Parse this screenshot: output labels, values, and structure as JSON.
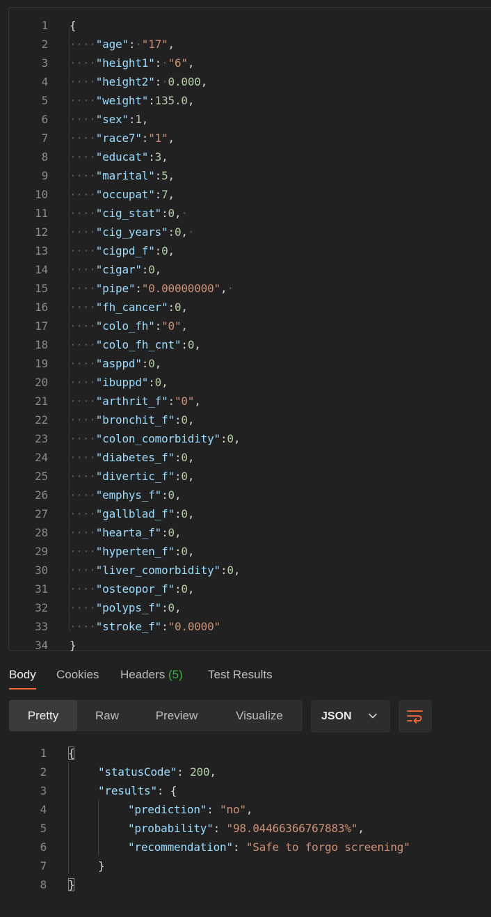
{
  "request_body": {
    "lines": [
      {
        "n": "1",
        "indent": 0,
        "tokens": [
          {
            "t": "{",
            "c": "pun"
          }
        ]
      },
      {
        "n": "2",
        "indent": 1,
        "tokens": [
          {
            "t": "\"age\"",
            "c": "key"
          },
          {
            "t": ":",
            "c": "pun"
          },
          {
            "t": "·",
            "c": "ws"
          },
          {
            "t": "\"17\"",
            "c": "str"
          },
          {
            "t": ",",
            "c": "pun"
          }
        ]
      },
      {
        "n": "3",
        "indent": 1,
        "tokens": [
          {
            "t": "\"height1\"",
            "c": "key"
          },
          {
            "t": ":",
            "c": "pun"
          },
          {
            "t": "·",
            "c": "ws"
          },
          {
            "t": "\"6\"",
            "c": "str"
          },
          {
            "t": ",",
            "c": "pun"
          }
        ]
      },
      {
        "n": "4",
        "indent": 1,
        "tokens": [
          {
            "t": "\"height2\"",
            "c": "key"
          },
          {
            "t": ":",
            "c": "pun"
          },
          {
            "t": "·",
            "c": "ws"
          },
          {
            "t": "0.000",
            "c": "num"
          },
          {
            "t": ",",
            "c": "pun"
          }
        ]
      },
      {
        "n": "5",
        "indent": 1,
        "tokens": [
          {
            "t": "\"weight\"",
            "c": "key"
          },
          {
            "t": ":",
            "c": "pun"
          },
          {
            "t": "135.0",
            "c": "num"
          },
          {
            "t": ",",
            "c": "pun"
          }
        ]
      },
      {
        "n": "6",
        "indent": 1,
        "tokens": [
          {
            "t": "\"sex\"",
            "c": "key"
          },
          {
            "t": ":",
            "c": "pun"
          },
          {
            "t": "1",
            "c": "num"
          },
          {
            "t": ",",
            "c": "pun"
          }
        ]
      },
      {
        "n": "7",
        "indent": 1,
        "tokens": [
          {
            "t": "\"race7\"",
            "c": "key"
          },
          {
            "t": ":",
            "c": "pun"
          },
          {
            "t": "\"1\"",
            "c": "str"
          },
          {
            "t": ",",
            "c": "pun"
          }
        ]
      },
      {
        "n": "8",
        "indent": 1,
        "tokens": [
          {
            "t": "\"educat\"",
            "c": "key"
          },
          {
            "t": ":",
            "c": "pun"
          },
          {
            "t": "3",
            "c": "num"
          },
          {
            "t": ",",
            "c": "pun"
          }
        ]
      },
      {
        "n": "9",
        "indent": 1,
        "tokens": [
          {
            "t": "\"marital\"",
            "c": "key"
          },
          {
            "t": ":",
            "c": "pun"
          },
          {
            "t": "5",
            "c": "num"
          },
          {
            "t": ",",
            "c": "pun"
          }
        ]
      },
      {
        "n": "10",
        "indent": 1,
        "tokens": [
          {
            "t": "\"occupat\"",
            "c": "key"
          },
          {
            "t": ":",
            "c": "pun"
          },
          {
            "t": "7",
            "c": "num"
          },
          {
            "t": ",",
            "c": "pun"
          }
        ]
      },
      {
        "n": "11",
        "indent": 1,
        "tokens": [
          {
            "t": "\"cig_stat\"",
            "c": "key"
          },
          {
            "t": ":",
            "c": "pun"
          },
          {
            "t": "0",
            "c": "num"
          },
          {
            "t": ",",
            "c": "pun"
          },
          {
            "t": "·",
            "c": "ws"
          }
        ]
      },
      {
        "n": "12",
        "indent": 1,
        "tokens": [
          {
            "t": "\"cig_years\"",
            "c": "key"
          },
          {
            "t": ":",
            "c": "pun"
          },
          {
            "t": "0",
            "c": "num"
          },
          {
            "t": ",",
            "c": "pun"
          },
          {
            "t": "·",
            "c": "ws"
          }
        ]
      },
      {
        "n": "13",
        "indent": 1,
        "tokens": [
          {
            "t": "\"cigpd_f\"",
            "c": "key"
          },
          {
            "t": ":",
            "c": "pun"
          },
          {
            "t": "0",
            "c": "num"
          },
          {
            "t": ",",
            "c": "pun"
          }
        ]
      },
      {
        "n": "14",
        "indent": 1,
        "tokens": [
          {
            "t": "\"cigar\"",
            "c": "key"
          },
          {
            "t": ":",
            "c": "pun"
          },
          {
            "t": "0",
            "c": "num"
          },
          {
            "t": ",",
            "c": "pun"
          }
        ]
      },
      {
        "n": "15",
        "indent": 1,
        "tokens": [
          {
            "t": "\"pipe\"",
            "c": "key"
          },
          {
            "t": ":",
            "c": "pun"
          },
          {
            "t": "\"0.00000000\"",
            "c": "str"
          },
          {
            "t": ",",
            "c": "pun"
          },
          {
            "t": "·",
            "c": "ws"
          }
        ]
      },
      {
        "n": "16",
        "indent": 1,
        "tokens": [
          {
            "t": "\"fh_cancer\"",
            "c": "key"
          },
          {
            "t": ":",
            "c": "pun"
          },
          {
            "t": "0",
            "c": "num"
          },
          {
            "t": ",",
            "c": "pun"
          }
        ]
      },
      {
        "n": "17",
        "indent": 1,
        "tokens": [
          {
            "t": "\"colo_fh\"",
            "c": "key"
          },
          {
            "t": ":",
            "c": "pun"
          },
          {
            "t": "\"0\"",
            "c": "str"
          },
          {
            "t": ",",
            "c": "pun"
          }
        ]
      },
      {
        "n": "18",
        "indent": 1,
        "tokens": [
          {
            "t": "\"colo_fh_cnt\"",
            "c": "key"
          },
          {
            "t": ":",
            "c": "pun"
          },
          {
            "t": "0",
            "c": "num"
          },
          {
            "t": ",",
            "c": "pun"
          }
        ]
      },
      {
        "n": "19",
        "indent": 1,
        "tokens": [
          {
            "t": "\"asppd\"",
            "c": "key"
          },
          {
            "t": ":",
            "c": "pun"
          },
          {
            "t": "0",
            "c": "num"
          },
          {
            "t": ",",
            "c": "pun"
          }
        ]
      },
      {
        "n": "20",
        "indent": 1,
        "tokens": [
          {
            "t": "\"ibuppd\"",
            "c": "key"
          },
          {
            "t": ":",
            "c": "pun"
          },
          {
            "t": "0",
            "c": "num"
          },
          {
            "t": ",",
            "c": "pun"
          }
        ]
      },
      {
        "n": "21",
        "indent": 1,
        "tokens": [
          {
            "t": "\"arthrit_f\"",
            "c": "key"
          },
          {
            "t": ":",
            "c": "pun"
          },
          {
            "t": "\"0\"",
            "c": "str"
          },
          {
            "t": ",",
            "c": "pun"
          }
        ]
      },
      {
        "n": "22",
        "indent": 1,
        "tokens": [
          {
            "t": "\"bronchit_f\"",
            "c": "key"
          },
          {
            "t": ":",
            "c": "pun"
          },
          {
            "t": "0",
            "c": "num"
          },
          {
            "t": ",",
            "c": "pun"
          }
        ]
      },
      {
        "n": "23",
        "indent": 1,
        "tokens": [
          {
            "t": "\"colon_comorbidity\"",
            "c": "key"
          },
          {
            "t": ":",
            "c": "pun"
          },
          {
            "t": "0",
            "c": "num"
          },
          {
            "t": ",",
            "c": "pun"
          }
        ]
      },
      {
        "n": "24",
        "indent": 1,
        "tokens": [
          {
            "t": "\"diabetes_f\"",
            "c": "key"
          },
          {
            "t": ":",
            "c": "pun"
          },
          {
            "t": "0",
            "c": "num"
          },
          {
            "t": ",",
            "c": "pun"
          }
        ]
      },
      {
        "n": "25",
        "indent": 1,
        "tokens": [
          {
            "t": "\"divertic_f\"",
            "c": "key"
          },
          {
            "t": ":",
            "c": "pun"
          },
          {
            "t": "0",
            "c": "num"
          },
          {
            "t": ",",
            "c": "pun"
          }
        ]
      },
      {
        "n": "26",
        "indent": 1,
        "tokens": [
          {
            "t": "\"emphys_f\"",
            "c": "key"
          },
          {
            "t": ":",
            "c": "pun"
          },
          {
            "t": "0",
            "c": "num"
          },
          {
            "t": ",",
            "c": "pun"
          }
        ]
      },
      {
        "n": "27",
        "indent": 1,
        "tokens": [
          {
            "t": "\"gallblad_f\"",
            "c": "key"
          },
          {
            "t": ":",
            "c": "pun"
          },
          {
            "t": "0",
            "c": "num"
          },
          {
            "t": ",",
            "c": "pun"
          }
        ]
      },
      {
        "n": "28",
        "indent": 1,
        "tokens": [
          {
            "t": "\"hearta_f\"",
            "c": "key"
          },
          {
            "t": ":",
            "c": "pun"
          },
          {
            "t": "0",
            "c": "num"
          },
          {
            "t": ",",
            "c": "pun"
          }
        ]
      },
      {
        "n": "29",
        "indent": 1,
        "tokens": [
          {
            "t": "\"hyperten_f\"",
            "c": "key"
          },
          {
            "t": ":",
            "c": "pun"
          },
          {
            "t": "0",
            "c": "num"
          },
          {
            "t": ",",
            "c": "pun"
          }
        ]
      },
      {
        "n": "30",
        "indent": 1,
        "tokens": [
          {
            "t": "\"liver_comorbidity\"",
            "c": "key"
          },
          {
            "t": ":",
            "c": "pun"
          },
          {
            "t": "0",
            "c": "num"
          },
          {
            "t": ",",
            "c": "pun"
          }
        ]
      },
      {
        "n": "31",
        "indent": 1,
        "tokens": [
          {
            "t": "\"osteopor_f\"",
            "c": "key"
          },
          {
            "t": ":",
            "c": "pun"
          },
          {
            "t": "0",
            "c": "num"
          },
          {
            "t": ",",
            "c": "pun"
          }
        ]
      },
      {
        "n": "32",
        "indent": 1,
        "tokens": [
          {
            "t": "\"polyps_f\"",
            "c": "key"
          },
          {
            "t": ":",
            "c": "pun"
          },
          {
            "t": "0",
            "c": "num"
          },
          {
            "t": ",",
            "c": "pun"
          }
        ]
      },
      {
        "n": "33",
        "indent": 1,
        "tokens": [
          {
            "t": "\"stroke_f\"",
            "c": "key"
          },
          {
            "t": ":",
            "c": "pun"
          },
          {
            "t": "\"0.0000\"",
            "c": "str"
          }
        ]
      },
      {
        "n": "34",
        "indent": 0,
        "tokens": [
          {
            "t": "}",
            "c": "pun"
          }
        ]
      }
    ]
  },
  "response_tabs": {
    "body": "Body",
    "cookies": "Cookies",
    "headers": "Headers",
    "headers_count": "(5)",
    "test_results": "Test Results"
  },
  "view_modes": {
    "pretty": "Pretty",
    "raw": "Raw",
    "preview": "Preview",
    "visualize": "Visualize",
    "selected": "Pretty"
  },
  "format_select": {
    "value": "JSON",
    "icon": "chevron-down-icon"
  },
  "wrap_button": {
    "icon": "wrap-lines-icon"
  },
  "response_body": {
    "lines": [
      {
        "n": "1",
        "indent": 0,
        "hl": true,
        "tokens": [
          {
            "t": "{",
            "c": "pun"
          }
        ]
      },
      {
        "n": "2",
        "indent": 1,
        "tokens": [
          {
            "t": "\"statusCode\"",
            "c": "key"
          },
          {
            "t": ": ",
            "c": "pun"
          },
          {
            "t": "200",
            "c": "num"
          },
          {
            "t": ",",
            "c": "pun"
          }
        ]
      },
      {
        "n": "3",
        "indent": 1,
        "tokens": [
          {
            "t": "\"results\"",
            "c": "key"
          },
          {
            "t": ": {",
            "c": "pun"
          }
        ]
      },
      {
        "n": "4",
        "indent": 2,
        "tokens": [
          {
            "t": "\"prediction\"",
            "c": "key"
          },
          {
            "t": ": ",
            "c": "pun"
          },
          {
            "t": "\"no\"",
            "c": "str"
          },
          {
            "t": ",",
            "c": "pun"
          }
        ]
      },
      {
        "n": "5",
        "indent": 2,
        "tokens": [
          {
            "t": "\"probability\"",
            "c": "key"
          },
          {
            "t": ": ",
            "c": "pun"
          },
          {
            "t": "\"98.04466366767883%\"",
            "c": "str"
          },
          {
            "t": ",",
            "c": "pun"
          }
        ]
      },
      {
        "n": "6",
        "indent": 2,
        "tokens": [
          {
            "t": "\"recommendation\"",
            "c": "key"
          },
          {
            "t": ": ",
            "c": "pun"
          },
          {
            "t": "\"Safe to forgo screening\"",
            "c": "str"
          }
        ]
      },
      {
        "n": "7",
        "indent": 1,
        "tokens": [
          {
            "t": "}",
            "c": "pun"
          }
        ]
      },
      {
        "n": "8",
        "indent": 0,
        "hl": true,
        "tokens": [
          {
            "t": "}",
            "c": "pun"
          }
        ]
      }
    ]
  },
  "colors": {
    "background": "#212121",
    "key": "#9cdcfe",
    "string": "#ce9178",
    "number": "#b5cea8",
    "accent_underline": "#ff6c37",
    "badge_green": "#3cb043"
  }
}
